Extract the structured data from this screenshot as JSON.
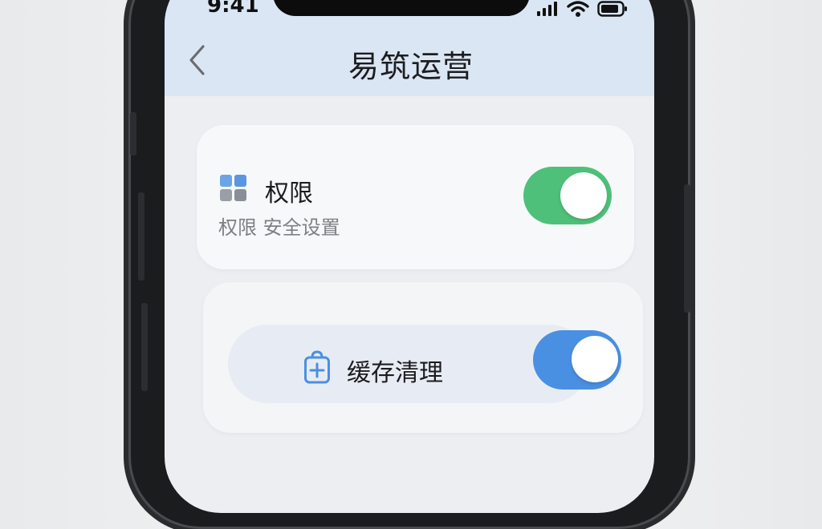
{
  "status_bar": {
    "time": "9:41"
  },
  "header": {
    "title": "易筑运营",
    "back_icon": "chevron-left-icon"
  },
  "permission_card": {
    "title": "权限 ",
    "subtitle": "权限  安全设置",
    "icon": "grid-icon",
    "toggle_on": true,
    "toggle_color": "#4ec07a"
  },
  "cache_card": {
    "label": "缓存清理",
    "icon": "bag-plus-icon",
    "toggle_on": true,
    "toggle_color": "#4a90e2"
  },
  "colors": {
    "accent_blue": "#4a90e2",
    "header_bg": "#dbe6f5"
  }
}
